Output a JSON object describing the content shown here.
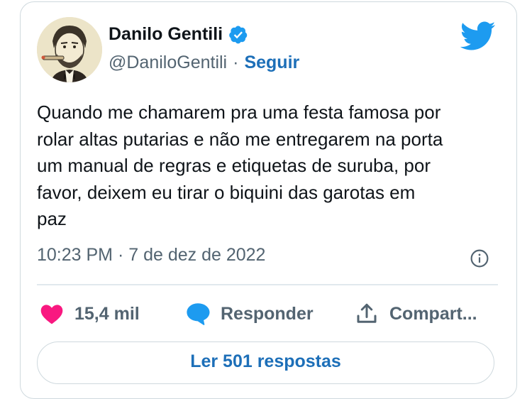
{
  "author": {
    "name": "Danilo Gentili",
    "handle": "@DaniloGentili",
    "separator": "·",
    "follow_label": "Seguir"
  },
  "tweet": {
    "text": "Quando me chamarem pra uma festa famosa por\nrolar altas putarias e não me entregarem na porta\num manual de regras e etiquetas de suruba, por\nfavor, deixem eu tirar o biquini das garotas em\npaz",
    "timestamp": "10:23 PM · 7 de dez de 2022"
  },
  "actions": {
    "likes": "15,4 mil",
    "reply_label": "Responder",
    "share_label": "Compart..."
  },
  "replies_button": "Ler 501 respostas",
  "colors": {
    "brand": "#1d9bf0",
    "link": "#1d6fb8",
    "like": "#f91880",
    "muted": "#536471",
    "border": "#cfd9de"
  },
  "icons": [
    "verified-badge-icon",
    "twitter-bird-icon",
    "info-icon",
    "heart-icon",
    "reply-bubble-icon",
    "share-icon"
  ]
}
